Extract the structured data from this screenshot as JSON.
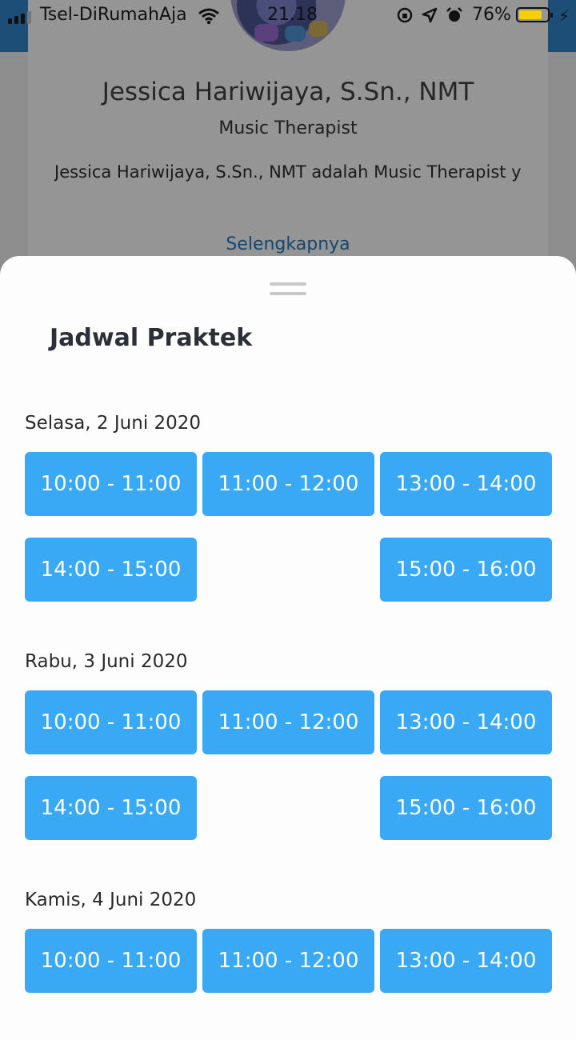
{
  "status_bar": {
    "carrier": "Tsel-DiRumahAja",
    "time": "21.18",
    "battery": "76%"
  },
  "background_profile": {
    "name": "Jessica Hariwijaya, S.Sn., NMT",
    "role": "Music Therapist",
    "description": "Jessica Hariwijaya, S.Sn., NMT adalah Music Therapist y",
    "more_link": "Selengkapnya"
  },
  "schedule_sheet": {
    "title": "Jadwal Praktek",
    "days": [
      {
        "label": "Selasa, 2 Juni 2020",
        "slots": [
          "10:00 - 11:00",
          "11:00 - 12:00",
          "13:00 - 14:00",
          "14:00 - 15:00",
          "",
          "15:00 - 16:00"
        ]
      },
      {
        "label": "Rabu, 3 Juni 2020",
        "slots": [
          "10:00 - 11:00",
          "11:00 - 12:00",
          "13:00 - 14:00",
          "14:00 - 15:00",
          "",
          "15:00 - 16:00"
        ]
      },
      {
        "label": "Kamis, 4 Juni 2020",
        "slots": [
          "10:00 - 11:00",
          "11:00 - 12:00",
          "13:00 - 14:00"
        ]
      }
    ]
  },
  "colors": {
    "slot_bg": "#3aa9f5",
    "battery_fill": "#f6cf00",
    "topbar": "#1d4e78"
  }
}
